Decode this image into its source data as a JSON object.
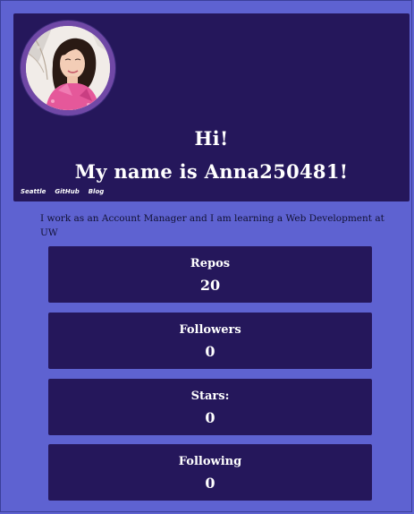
{
  "profile": {
    "greeting": "Hi!",
    "name_line": "My name is Anna250481!",
    "links": [
      "Seattle",
      "GitHub",
      "Blog"
    ],
    "bio": "I work as an Account Manager and I am learning a Web Development at UW"
  },
  "stats": [
    {
      "label": "Repos",
      "value": "20"
    },
    {
      "label": "Followers",
      "value": "0"
    },
    {
      "label": "Stars:",
      "value": "0"
    },
    {
      "label": "Following",
      "value": "0"
    }
  ],
  "colors": {
    "page_background": "#5e62d1",
    "panel_background": "#25175b",
    "avatar_ring": "#7048a6",
    "text_light": "#ffffff",
    "text_dark": "#111133"
  }
}
